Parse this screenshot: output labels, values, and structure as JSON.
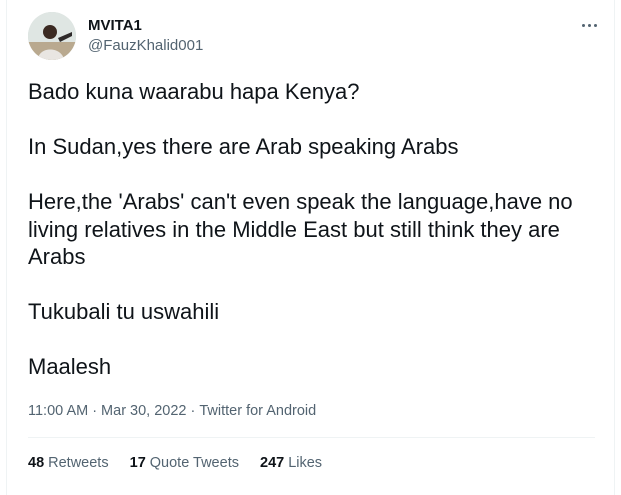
{
  "author": {
    "display_name": "MVITA1",
    "handle": "@FauzKhalid001"
  },
  "tweet": {
    "paragraphs": [
      "Bado kuna waarabu hapa Kenya?",
      "In Sudan,yes there are Arab speaking Arabs",
      "Here,the 'Arabs' can't even speak the language,have no living relatives in the Middle East but still think they are Arabs",
      "Tukubali tu uswahili",
      "Maalesh"
    ],
    "time": "11:00 AM",
    "date": "Mar 30, 2022",
    "separator": "·",
    "source": "Twitter for Android"
  },
  "stats": {
    "retweets_count": "48",
    "retweets_label": "Retweets",
    "quote_tweets_count": "17",
    "quote_tweets_label": "Quote Tweets",
    "likes_count": "247",
    "likes_label": "Likes"
  },
  "icons": {
    "more": "more-horizontal-icon"
  },
  "colors": {
    "text_primary": "#0f1419",
    "text_secondary": "#536471",
    "divider": "#eff3f4"
  }
}
